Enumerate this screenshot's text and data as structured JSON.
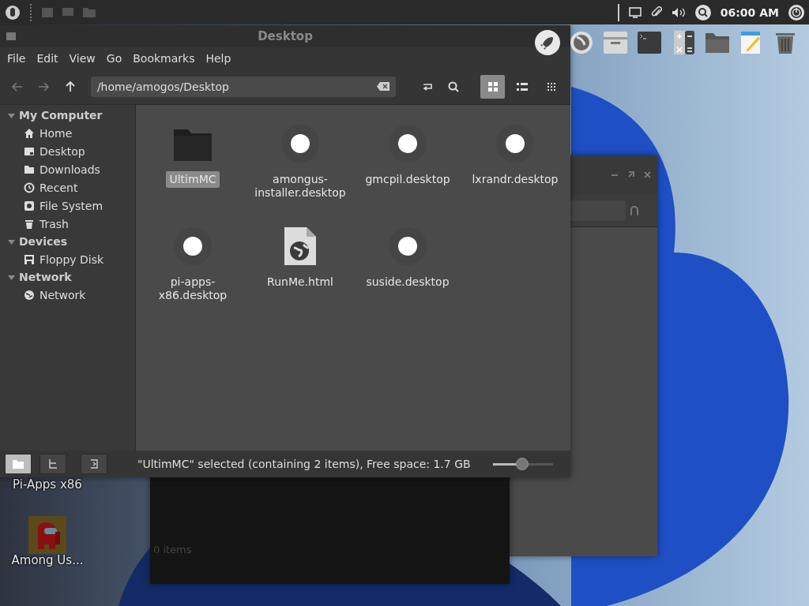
{
  "top_panel": {
    "clock": "06:00 AM"
  },
  "desktop_icons": [
    {
      "label": "Pi-Apps x86",
      "kind": "partial"
    },
    {
      "label": "Among Us...",
      "kind": "game"
    }
  ],
  "background_window": {
    "status": "0 items"
  },
  "window": {
    "title": "Desktop",
    "menu": [
      "File",
      "Edit",
      "View",
      "Go",
      "Bookmarks",
      "Help"
    ],
    "path": "/home/amogos/Desktop",
    "view_modes": [
      {
        "kind": "icons",
        "selected": true
      },
      {
        "kind": "list",
        "selected": false
      },
      {
        "kind": "compact",
        "selected": false
      }
    ],
    "sidebar": [
      {
        "label": "My Computer",
        "expanded": true,
        "children": [
          {
            "label": "Home",
            "kind": "home"
          },
          {
            "label": "Desktop",
            "kind": "desktop"
          },
          {
            "label": "Downloads",
            "kind": "folder"
          },
          {
            "label": "Recent",
            "kind": "recent"
          },
          {
            "label": "File System",
            "kind": "drive"
          },
          {
            "label": "Trash",
            "kind": "trash"
          }
        ]
      },
      {
        "label": "Devices",
        "expanded": true,
        "children": [
          {
            "label": "Floppy Disk",
            "kind": "floppy"
          }
        ]
      },
      {
        "label": "Network",
        "expanded": true,
        "children": [
          {
            "label": "Network",
            "kind": "network"
          }
        ]
      }
    ],
    "files": [
      {
        "name": "UltimMC",
        "kind": "folder",
        "selected": true
      },
      {
        "name": "amongus-installer.desktop",
        "kind": "launcher",
        "selected": false
      },
      {
        "name": "gmcpil.desktop",
        "kind": "launcher",
        "selected": false
      },
      {
        "name": "lxrandr.desktop",
        "kind": "launcher",
        "selected": false
      },
      {
        "name": "pi-apps-x86.desktop",
        "kind": "launcher",
        "selected": false
      },
      {
        "name": "RunMe.html",
        "kind": "html",
        "selected": false
      },
      {
        "name": "suside.desktop",
        "kind": "launcher",
        "selected": false
      }
    ],
    "pane_buttons": [
      {
        "kind": "places",
        "selected": true
      },
      {
        "kind": "tree",
        "selected": false
      },
      {
        "kind": "close",
        "selected": false
      }
    ],
    "status": "\"UltimMC\" selected (containing 2 items), Free space: 1.7 GB",
    "zoom": {
      "level": 0.49
    }
  }
}
